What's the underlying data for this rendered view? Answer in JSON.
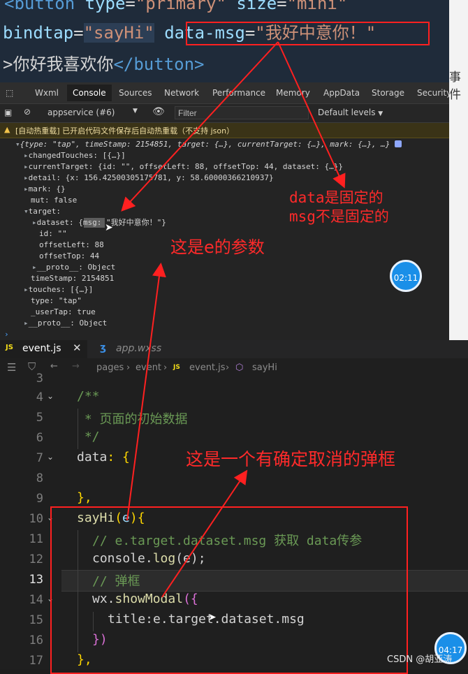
{
  "top_code": {
    "line1": {
      "tag": "<button",
      "attr1": "type",
      "val1": "\"primary\"",
      "attr2": "size",
      "val2": "\"mini\""
    },
    "line2": {
      "attr": "bindtap",
      "val": "\"sayHi\"",
      "attr2": "data-msg",
      "val2": "\"我好中意你！\""
    },
    "line3": {
      "text": ">你好我喜欢你",
      "close": "</button>"
    }
  },
  "right_sliver_text": "事件",
  "devtools": {
    "tabs": [
      "Wxml",
      "Console",
      "Sources",
      "Network",
      "Performance",
      "Memory",
      "AppData",
      "Storage",
      "Security"
    ],
    "active_tab": "Console",
    "context": "appservice (#6)",
    "filter_placeholder": "Filter",
    "levels": "Default levels",
    "warning": "[自动热重载] 已开启代码文件保存后自动热重载（不支持 json）",
    "console_lines": [
      "{type: \"tap\", timeStamp: 2154851, target: {…}, currentTarget: {…}, mark: {…}, …}",
      "changedTouches: [{…}]",
      "currentTarget: {id: \"\", offsetLeft: 88, offsetTop: 44, dataset: {…}}",
      "detail: {x: 156.42500305175781, y: 58.60000366210937}",
      "mark: {}",
      "mut: false",
      "target:",
      "dataset: {msg: \"我好中意你！\"}",
      "id: \"\"",
      "offsetLeft: 88",
      "offsetTop: 44",
      "__proto__: Object",
      "timeStamp: 2154851",
      "touches: [{…}]",
      "type: \"tap\"",
      "_userTap: true",
      "__proto__: Object"
    ]
  },
  "editor": {
    "tabs": [
      {
        "label": "event.js",
        "icon": "JS"
      },
      {
        "label": "app.wxss",
        "icon": "wxss"
      }
    ],
    "breadcrumb": [
      "pages",
      "event",
      "event.js",
      "sayHi"
    ],
    "line_numbers": [
      "3",
      "4",
      "5",
      "6",
      "7",
      "8",
      "9",
      "10",
      "11",
      "12",
      "13",
      "14",
      "15",
      "16",
      "17"
    ],
    "current_line": "13",
    "lines": {
      "l4": "/**",
      "l5": " * 页面的初始数据",
      "l6": " */",
      "l7a": "data",
      "l7b": ": {",
      "l9": "},",
      "l10a": "sayHi",
      "l10b": "(",
      "l10c": "e",
      "l10d": "){",
      "l11": "// e.target.dataset.msg 获取 data传参",
      "l12a": "console.",
      "l12b": "log",
      "l12c": "(e);",
      "l13": "// 弹框",
      "l14a": "wx.",
      "l14b": "showModal",
      "l14c": "({",
      "l15": "title:e.target.dataset.msg",
      "l16": "})",
      "l17": "},"
    }
  },
  "annotations": {
    "note1": "data是固定的",
    "note2": "msg不是固定的",
    "note3": "这是e的参数",
    "note4": "这是一个有确定取消的弹框"
  },
  "timers": [
    "02:11",
    "04:17"
  ],
  "watermark": "CSDN @胡亚涛"
}
